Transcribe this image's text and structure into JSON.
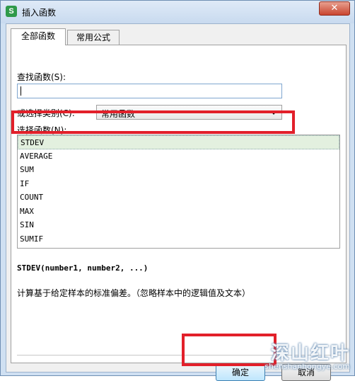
{
  "window": {
    "title": "插入函数",
    "app_icon_glyph": "S",
    "close_glyph": "✕"
  },
  "tabs": [
    {
      "label": "全部函数",
      "active": true
    },
    {
      "label": "常用公式",
      "active": false
    }
  ],
  "search": {
    "label": "查找函数(S):",
    "value": ""
  },
  "category": {
    "label": "或选择类别(C):",
    "selected": "常用函数"
  },
  "function_list": {
    "label": "选择函数(N):",
    "items": [
      "STDEV",
      "AVERAGE",
      "SUM",
      "IF",
      "COUNT",
      "MAX",
      "SIN",
      "SUMIF"
    ],
    "selected_index": 0
  },
  "signature": "STDEV(number1, number2, ...)",
  "description": "计算基于给定样本的标准偏差。（忽略样本中的逻辑值及文本）",
  "buttons": {
    "ok": "确定",
    "cancel": "取消"
  },
  "watermark": {
    "text": "深山红叶",
    "url": "shenshanhongye.com"
  },
  "colors": {
    "highlight": "#e2202a",
    "selected_row": "#e3f0df",
    "app_icon": "#2f9a4a"
  }
}
